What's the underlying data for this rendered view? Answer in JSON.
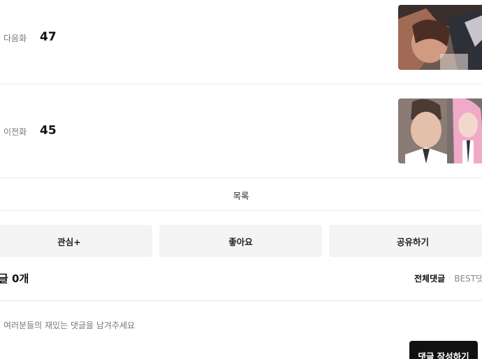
{
  "episodes": {
    "next": {
      "label": "다음화",
      "number": "47"
    },
    "prev": {
      "label": "이전화",
      "number": "45"
    }
  },
  "list_label": "목록",
  "actions": {
    "subscribe": "관심+",
    "like": "좋아요",
    "share": "공유하기"
  },
  "comments": {
    "title": "글 0개",
    "tab_all": "전체댓글",
    "tab_separator": "·",
    "tab_best": "BEST댓",
    "placeholder": "여러분들의 재밌는 댓글을 남겨주세요",
    "write_button": "댓글 작성하기"
  },
  "colors": {
    "button_bg": "#f4f4f4",
    "primary_button_bg": "#111111",
    "divider": "#ececec"
  }
}
